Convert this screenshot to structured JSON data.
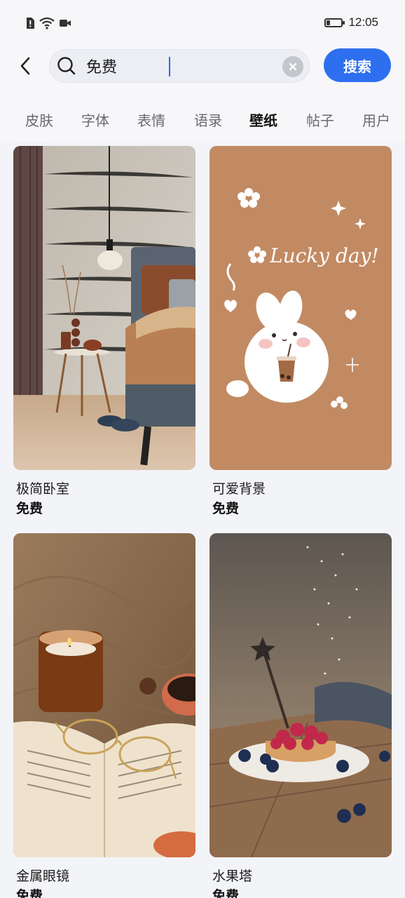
{
  "status_bar": {
    "time": "12:05",
    "icons": [
      "alert-icon",
      "wifi-icon",
      "video-icon",
      "battery-icon"
    ],
    "battery_level": 0.2
  },
  "search": {
    "value": "免费",
    "placeholder": "",
    "button_label": "搜索"
  },
  "tabs": [
    {
      "label": "皮肤",
      "active": false
    },
    {
      "label": "字体",
      "active": false
    },
    {
      "label": "表情",
      "active": false
    },
    {
      "label": "语录",
      "active": false
    },
    {
      "label": "壁纸",
      "active": true
    },
    {
      "label": "帖子",
      "active": false
    },
    {
      "label": "用户",
      "active": false
    }
  ],
  "wallpapers": [
    {
      "title": "极简卧室",
      "price": "免费",
      "image": "minimal-bedroom"
    },
    {
      "title": "可爱背景",
      "price": "免费",
      "image": "cute-bunny-lucky-day",
      "overlay_text": "Lucky day!"
    },
    {
      "title": "金属眼镜",
      "price": "免费",
      "image": "glasses-on-book-candle"
    },
    {
      "title": "水果塔",
      "price": "免费",
      "image": "berry-tart"
    }
  ],
  "colors": {
    "accent": "#2e6ff0",
    "background": "#f3f4f8",
    "cute_bg": "#c28a62"
  }
}
